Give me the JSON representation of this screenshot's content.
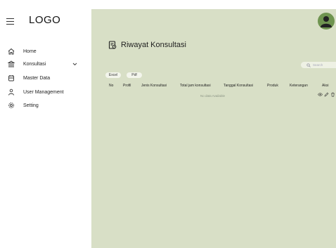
{
  "sidebar": {
    "logo": "LOGO",
    "items": [
      {
        "label": "Home",
        "icon": "home-icon"
      },
      {
        "label": "Konsultasi",
        "icon": "bank-icon"
      },
      {
        "label": "Master Data",
        "icon": "database-icon"
      },
      {
        "label": "User Management",
        "icon": "user-icon"
      },
      {
        "label": "Setting",
        "icon": "gear-icon"
      }
    ]
  },
  "header": {
    "avatar_icon": "user-avatar-icon"
  },
  "main": {
    "title": "Riwayat Konsultasi",
    "search_placeholder": "Search",
    "export_buttons": [
      "Excel",
      "Pdf"
    ],
    "table": {
      "columns": [
        "No",
        "Profil",
        "Jenis Konsultasi",
        "Total jam konsultasi",
        "Tanggal Konsultasi",
        "Produk",
        "Keterangan",
        "Aksi"
      ],
      "empty_text": "No data Available",
      "actions": [
        "view-icon",
        "edit-icon",
        "delete-icon"
      ]
    }
  },
  "colors": {
    "content_bg": "#d8dfc6",
    "avatar": "#6f9450"
  }
}
